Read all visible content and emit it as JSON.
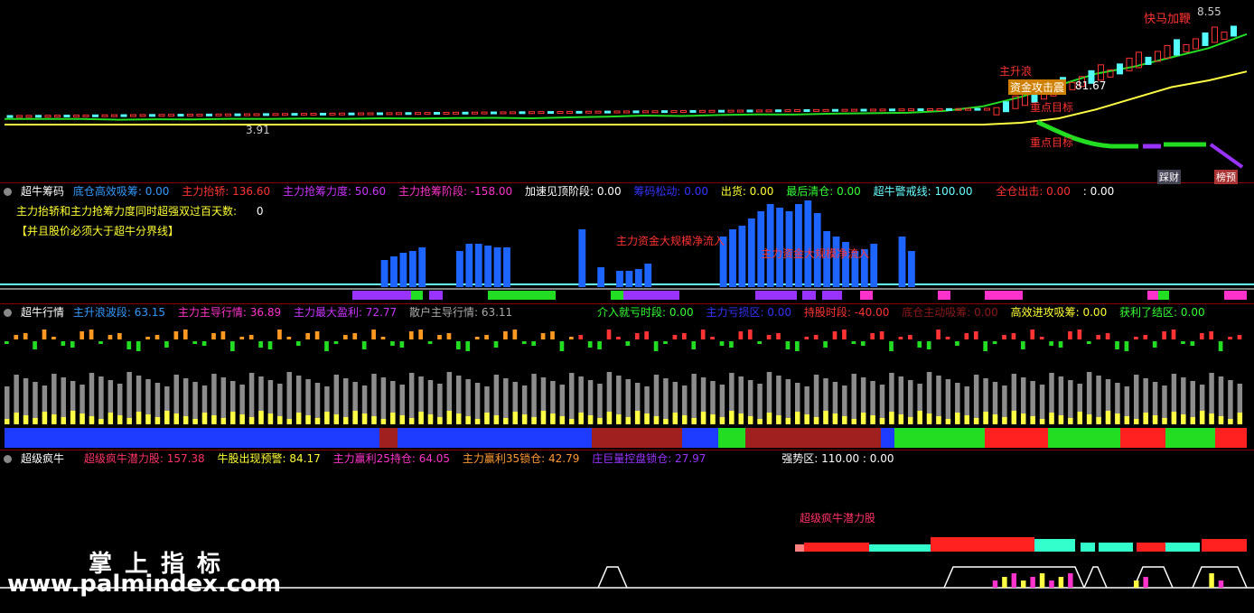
{
  "colors": {
    "bg": "#000000",
    "up": "#ff3333",
    "down": "#55ffff",
    "green": "#22dd22",
    "yellow": "#ffff44",
    "blue": "#1e64ff",
    "purple": "#9933ff",
    "magenta": "#ff33cc",
    "gray": "#8c8c8c",
    "orange": "#ff9922"
  },
  "price_panel": {
    "high_label": "8.55",
    "low_label": "3.91",
    "value_label": "81.67",
    "annotations": [
      "快马加鞭",
      "主升浪",
      "资金攻击震",
      "重点目标",
      "重点目标",
      "踩财",
      "榜预"
    ]
  },
  "panel2": {
    "title": "超牛筹码",
    "items": [
      {
        "text": "底仓高效吸筹: 0.00",
        "color": "#3399ff"
      },
      {
        "text": "主力抬轿: 136.60",
        "color": "#ff3333"
      },
      {
        "text": "主力抢筹力度: 50.60",
        "color": "#cc33ff"
      },
      {
        "text": "主力抢筹阶段: -158.00",
        "color": "#ff33cc"
      },
      {
        "text": "加速见顶阶段: 0.00",
        "color": "#ffffff"
      },
      {
        "text": "筹码松动: 0.00",
        "color": "#3333ff"
      },
      {
        "text": "出货: 0.00",
        "color": "#ffff33"
      },
      {
        "text": "最后清仓: 0.00",
        "color": "#33ff33"
      },
      {
        "text": "超牛警戒线: 100.00",
        "color": "#66ffff"
      },
      {
        "text": "全仓出击: 0.00",
        "color": "#ff3333"
      },
      {
        "text": ": 0.00",
        "color": "#ffffff"
      }
    ],
    "line2": "主力抬轿和主力抢筹力度同时超强双过百天数:",
    "line2_value": "0",
    "line3": "【并且股价必须大于超牛分界线】",
    "annotation1": "主力资金大规模净流入",
    "annotation2": "主力资金大规模净流入"
  },
  "panel3": {
    "title": "超牛行情",
    "items": [
      {
        "text": "主升浪波段: 63.15",
        "color": "#3399ff"
      },
      {
        "text": "主力主导行情: 36.89",
        "color": "#ff33cc"
      },
      {
        "text": "主力最大盈利: 72.77",
        "color": "#cc33ff"
      },
      {
        "text": "散户主导行情: 63.11",
        "color": "#aaaaaa"
      },
      {
        "text": "介入就亏时段: 0.00",
        "color": "#33ff33"
      },
      {
        "text": "主力亏损区: 0.00",
        "color": "#3333ff"
      },
      {
        "text": "持股时段: -40.00",
        "color": "#ff3333"
      },
      {
        "text": "底仓主动吸筹: 0.00",
        "color": "#8b1a1a"
      },
      {
        "text": "高效进攻吸筹: 0.00",
        "color": "#ffff33"
      },
      {
        "text": "获利了结区: 0.00",
        "color": "#33ff33"
      }
    ]
  },
  "panel4": {
    "title": "超级疯牛",
    "items": [
      {
        "text": "超级疯牛潜力股: 157.38",
        "color": "#ff3366"
      },
      {
        "text": "牛股出现预警: 84.17",
        "color": "#ffff33"
      },
      {
        "text": "主力赢利25持仓: 64.05",
        "color": "#ff33cc"
      },
      {
        "text": "主力赢利35锁仓: 42.79",
        "color": "#ff9933"
      },
      {
        "text": "庄巨量控盘锁仓: 27.97",
        "color": "#9933ff"
      },
      {
        "text": "强势区: 110.00 : 0.00",
        "color": "#ffffff"
      }
    ],
    "annotation": "超级疯牛潜力股"
  },
  "watermark": {
    "line1": "掌上指标",
    "line2": "www.palmindex.com"
  },
  "chart_data": [
    {
      "type": "line",
      "title": "",
      "series": [
        {
          "values": [
            3.95,
            3.92,
            3.94,
            3.93,
            3.96,
            3.95,
            3.97,
            3.96,
            3.98,
            3.97,
            3.99,
            4.0,
            3.98,
            4.02,
            4.05,
            4.1,
            4.08,
            4.12,
            4.15,
            4.14,
            4.18,
            4.2,
            4.22,
            4.3,
            4.5,
            4.9,
            5.4,
            5.9,
            6.2,
            6.6,
            7.0,
            7.6,
            8.1,
            8.55
          ]
        }
      ]
    },
    {
      "type": "bar",
      "title": "",
      "series": [
        {
          "values": [
            0,
            0,
            0,
            0,
            0,
            0,
            0,
            0,
            0,
            0,
            0,
            0,
            0,
            0,
            0,
            0,
            0,
            0,
            0,
            0,
            0,
            0,
            0,
            0,
            0,
            0,
            0,
            0,
            0,
            0,
            0,
            0,
            0,
            0,
            0,
            0,
            0,
            0,
            0,
            0,
            0,
            0,
            0,
            0,
            0,
            0,
            0,
            0,
            0,
            0,
            0,
            0,
            0,
            0,
            0,
            0,
            0,
            0,
            0,
            0,
            0,
            0,
            0,
            0,
            0,
            0,
            0,
            0,
            0,
            0,
            0,
            0,
            0,
            0,
            0,
            0,
            0,
            0,
            0,
            0,
            0,
            0,
            0,
            0,
            0,
            0,
            0,
            0,
            0,
            0,
            0,
            0,
            0,
            0,
            0,
            0,
            0,
            0,
            0,
            0,
            0,
            0,
            0,
            0,
            0,
            0,
            0,
            0,
            0,
            0,
            0,
            0,
            0,
            0,
            0,
            0,
            0,
            0,
            0,
            0,
            0,
            0,
            0,
            0,
            0,
            0,
            0,
            0,
            0,
            0,
            0,
            0,
            0,
            0,
            0
          ]
        }
      ]
    },
    {
      "type": "bar",
      "title": "",
      "series": [
        {
          "values": [
            0,
            0,
            0,
            0,
            0,
            0,
            0,
            0,
            0,
            0,
            0,
            0,
            0,
            0,
            0,
            0,
            0,
            0,
            0,
            0,
            0,
            0,
            0,
            0,
            0,
            0,
            0,
            0,
            0,
            0,
            0,
            0,
            0,
            0,
            0,
            0,
            0,
            0,
            0,
            0,
            0,
            0,
            0,
            0,
            0,
            0,
            0,
            0,
            0,
            0,
            0,
            0,
            0,
            0,
            0,
            0,
            0,
            0,
            0,
            0,
            0,
            0,
            0,
            0,
            0,
            0,
            0,
            0,
            0,
            0,
            0,
            0,
            0,
            0,
            0,
            0,
            0,
            0,
            0,
            0,
            0,
            0,
            0,
            0,
            0,
            0,
            0,
            0,
            0,
            0,
            0,
            0,
            0,
            0,
            0,
            0,
            0,
            0,
            0,
            0,
            0,
            0,
            0,
            0,
            0,
            0,
            0,
            0,
            0,
            0,
            0,
            0,
            0,
            0,
            0,
            0,
            0,
            0,
            0,
            0,
            0,
            0,
            0,
            0,
            0,
            0,
            0,
            0,
            0,
            0,
            0,
            0,
            0,
            0,
            0
          ]
        }
      ]
    },
    {
      "type": "bar",
      "title": "",
      "series": [
        {
          "values": [
            0,
            0,
            0,
            0,
            0,
            0,
            0,
            0,
            0,
            0,
            0,
            0,
            0,
            0,
            0,
            0,
            0,
            0,
            0,
            0,
            0,
            0,
            0,
            0,
            0,
            0,
            0,
            0,
            0,
            0,
            0,
            0,
            0,
            0,
            0,
            0,
            0,
            0,
            0,
            0,
            0,
            0,
            0,
            0,
            0,
            0,
            0,
            0,
            0,
            0,
            0,
            0,
            0,
            0,
            0,
            0,
            0,
            0,
            0,
            0,
            0,
            0,
            0,
            0,
            0,
            0,
            0,
            0,
            0,
            0,
            0,
            0,
            0,
            0,
            0,
            0,
            0,
            0,
            0,
            0,
            0,
            0,
            0,
            0,
            0,
            0,
            0,
            0,
            0,
            0,
            0,
            0,
            0,
            0,
            0,
            0,
            0,
            0,
            0,
            0,
            0,
            0,
            0,
            0,
            0,
            0,
            0,
            0,
            0,
            0,
            0,
            0,
            0,
            0,
            0,
            0,
            0,
            0,
            0,
            0,
            0,
            0,
            0,
            0,
            0,
            0,
            0,
            0,
            0,
            0,
            0,
            0,
            0,
            0,
            0
          ]
        }
      ]
    }
  ]
}
